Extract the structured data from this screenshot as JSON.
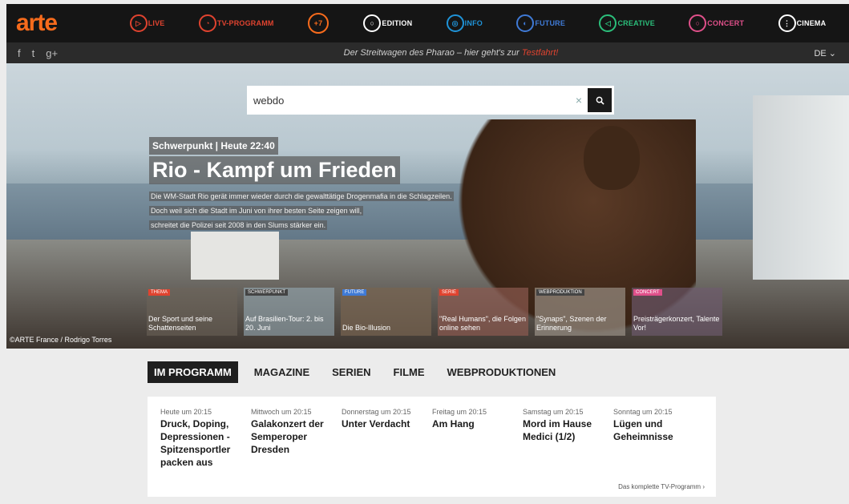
{
  "topnav": {
    "logo": "arte",
    "items": [
      {
        "label": "LIVE",
        "color": "#e0432f"
      },
      {
        "label": "TV-PROGRAMM",
        "color": "#e0432f"
      },
      {
        "label": "+7",
        "color": "#f76b1c"
      },
      {
        "label": "EDITION",
        "color": "#ffffff"
      },
      {
        "label": "INFO",
        "color": "#1f93d8"
      },
      {
        "label": "FUTURE",
        "color": "#3f7ad6"
      },
      {
        "label": "CREATIVE",
        "color": "#2bbf7b"
      },
      {
        "label": "CONCERT",
        "color": "#e0508a"
      },
      {
        "label": "CINEMA",
        "color": "#ffffff"
      }
    ]
  },
  "subbar": {
    "social": [
      "f",
      "t",
      "g+"
    ],
    "teaser_text": "Der Streitwagen des Pharao – hier geht's zur ",
    "teaser_link": "Testfahrt!",
    "lang": "DE"
  },
  "search": {
    "value": "webdo"
  },
  "hero": {
    "kicker": "Schwerpunkt | Heute 22:40",
    "title": "Rio - Kampf um Frieden",
    "desc": [
      "Die WM-Stadt Rio gerät immer wieder durch die gewalttätige Drogenmafia in die Schlagzeilen.",
      "Doch weil sich die Stadt im Juni von ihrer besten Seite zeigen will,",
      "schreitet die Polizei seit 2008 in den Slums stärker ein."
    ],
    "credit": "©ARTE France / Rodrigo Torres",
    "cards": [
      {
        "tag": "THEMA",
        "tag_color": "#e0432f",
        "title": "Der Sport und seine Schattenseiten"
      },
      {
        "tag": "SCHWERPUNKT",
        "tag_color": "#444444",
        "title": "Auf Brasilien-Tour: 2. bis 20. Juni"
      },
      {
        "tag": "FUTURE",
        "tag_color": "#3f7ad6",
        "title": "Die Bio-Illusion"
      },
      {
        "tag": "SERIE",
        "tag_color": "#e0432f",
        "title": "\"Real Humans\", die Folgen online sehen"
      },
      {
        "tag": "WEBPRODUKTION",
        "tag_color": "#444444",
        "title": "\"Synaps\", Szenen der Erinnerung"
      },
      {
        "tag": "CONCERT",
        "tag_color": "#e0508a",
        "title": "Preisträgerkonzert, Talente Vor!"
      }
    ]
  },
  "tabs": [
    "IM PROGRAMM",
    "MAGAZINE",
    "SERIEN",
    "FILME",
    "WEBPRODUKTIONEN"
  ],
  "program": {
    "days": [
      {
        "when": "Heute um 20:15",
        "title": "Druck, Doping, Depressionen - Spitzensportler packen aus"
      },
      {
        "when": "Mittwoch um 20:15",
        "title": "Galakonzert der Semperoper Dresden"
      },
      {
        "when": "Donnerstag um 20:15",
        "title": "Unter Verdacht"
      },
      {
        "when": "Freitag um 20:15",
        "title": "Am Hang"
      },
      {
        "when": "Samstag um 20:15",
        "title": "Mord im Hause Medici (1/2)"
      },
      {
        "when": "Sonntag um 20:15",
        "title": "Lügen und Geheimnisse"
      }
    ],
    "more_link": "Das komplette TV-Programm"
  }
}
